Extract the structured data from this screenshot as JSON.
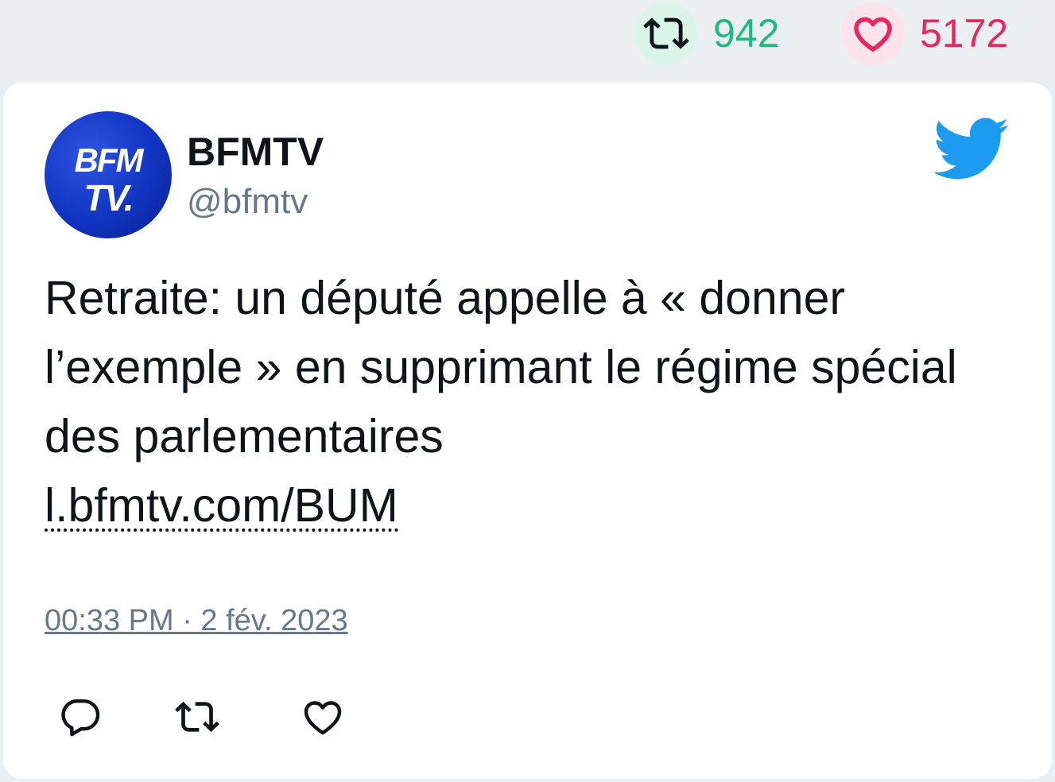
{
  "stats": {
    "retweets": "942",
    "likes": "5172",
    "retweet_color": "#1fba7f",
    "like_color": "#e8285c"
  },
  "author": {
    "name": "BFMTV",
    "handle": "@bfmtv",
    "avatar_line1": "BFM",
    "avatar_line2": "TV."
  },
  "tweet": {
    "text": "Retraite: un député appelle à « donner l’exemple » en supprimant le régime spécial des parlementaires",
    "link": "l.bfmtv.com/BUM",
    "timestamp": "00:33 PM · 2 fév. 2023"
  },
  "icons": {
    "brand": "twitter-bird-icon",
    "reply": "reply-icon",
    "retweet": "retweet-icon",
    "like": "heart-icon"
  },
  "colors": {
    "brand_blue": "#1d9bf0",
    "text": "#0f1419",
    "muted": "#66788a"
  }
}
